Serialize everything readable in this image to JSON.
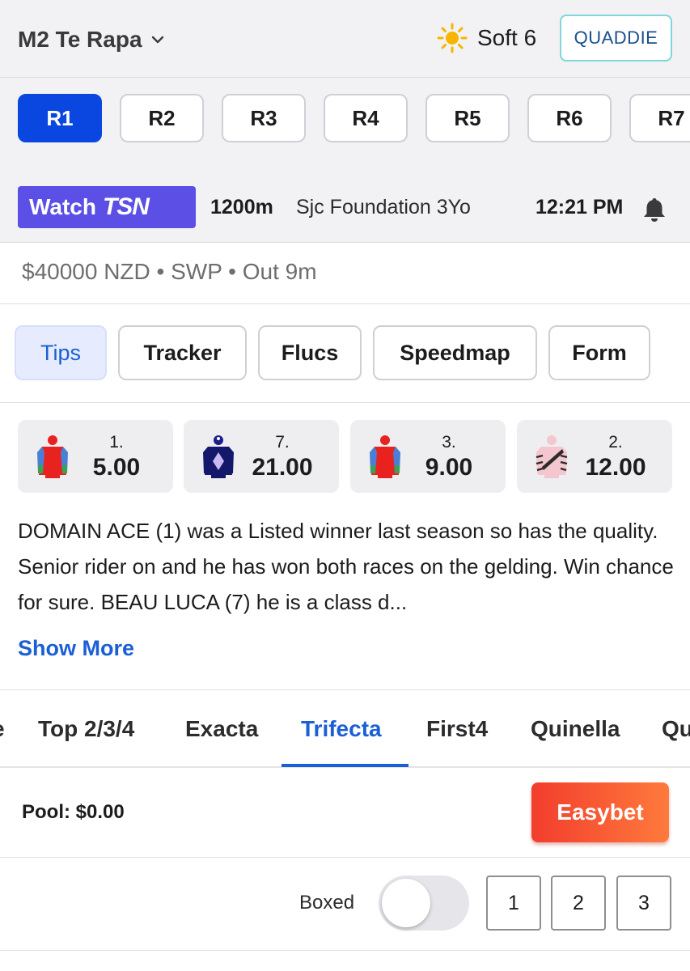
{
  "header": {
    "venue": "M2 Te Rapa",
    "weather_icon": "sun-icon",
    "track_condition": "Soft 6",
    "quaddie_label": "QUADDIE"
  },
  "races": [
    "R1",
    "R2",
    "R3",
    "R4",
    "R5",
    "R6",
    "R7"
  ],
  "active_race": "R1",
  "race_info": {
    "watch_label": "Watch",
    "channel": "TSN",
    "distance": "1200m",
    "name": "Sjc Foundation 3Yo",
    "time": "12:21 PM",
    "prize_line": "$40000 NZD • SWP • Out 9m"
  },
  "subtabs": [
    "Tips",
    "Tracker",
    "Flucs",
    "Speedmap",
    "Form"
  ],
  "active_subtab": "Tips",
  "tips": [
    {
      "number": "1.",
      "odds": "5.00",
      "silk": "red-silk-icon"
    },
    {
      "number": "7.",
      "odds": "21.00",
      "silk": "navy-diamond-silk-icon"
    },
    {
      "number": "3.",
      "odds": "9.00",
      "silk": "red-silk-icon"
    },
    {
      "number": "2.",
      "odds": "12.00",
      "silk": "pink-striped-silk-icon"
    }
  ],
  "tip_text": "DOMAIN ACE (1) was a Listed winner last season so has the quality. Senior rider on and he has won both races on the gelding. Win chance for sure. BEAU LUCA (7) he is a class d...",
  "show_more": "Show More",
  "bet_types": [
    "e",
    "Top 2/3/4",
    "Exacta",
    "Trifecta",
    "First4",
    "Quinella",
    "Qu"
  ],
  "active_bet_type": "Trifecta",
  "pool": "Pool: $0.00",
  "easybet_label": "Easybet",
  "boxed_label": "Boxed",
  "boxed_on": false,
  "positions": [
    "1",
    "2",
    "3"
  ],
  "colors": {
    "primary": "#0a47e0",
    "link": "#1b5fd6",
    "watch_bg": "#5b4fe6",
    "easybet_start": "#f23d2d",
    "easybet_end": "#ff7a3c"
  }
}
